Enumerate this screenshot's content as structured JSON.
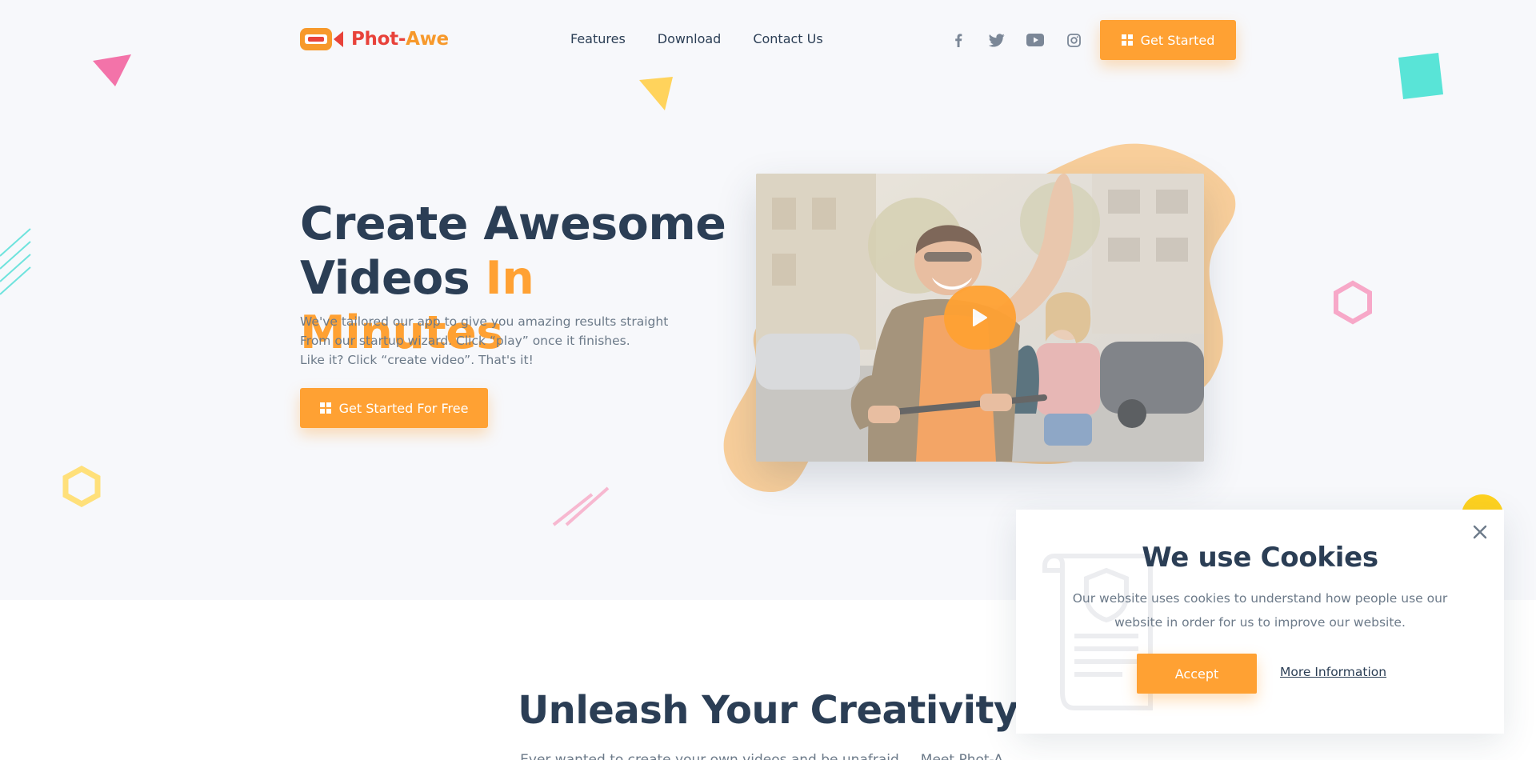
{
  "brand": {
    "name_part1": "Phot-",
    "name_part2": "Awe",
    "accent_color": "#ffa133",
    "logo_red": "#e8423a",
    "heading_color": "#2b3e55"
  },
  "nav": {
    "items": [
      {
        "label": "Features"
      },
      {
        "label": "Download"
      },
      {
        "label": "Contact Us"
      }
    ]
  },
  "social": {
    "icons": [
      "facebook-icon",
      "twitter-icon",
      "youtube-icon",
      "instagram-icon"
    ]
  },
  "header": {
    "cta_label": "Get Started"
  },
  "hero": {
    "title_line1": "Create Awesome",
    "title_line2_plain": "Videos ",
    "title_line2_accent": "In Minutes",
    "desc_line1": "We've tailored our app to give you amazing results straight",
    "desc_line2": "From our startup wizard. Click “play” once it finishes.",
    "desc_line3": "Like it? Click “create video”. That's it!",
    "cta_label": "Get Started For Free"
  },
  "section": {
    "title": "Unleash Your Creativity",
    "subtitle": "Ever wanted to create your own videos and be unafraid ... Meet Phot-A..."
  },
  "cookie": {
    "title": "We use Cookies",
    "text": "Our website uses cookies to understand how people use our website in order for us to improve our website.",
    "accept_label": "Accept",
    "more_label": "More Information"
  }
}
